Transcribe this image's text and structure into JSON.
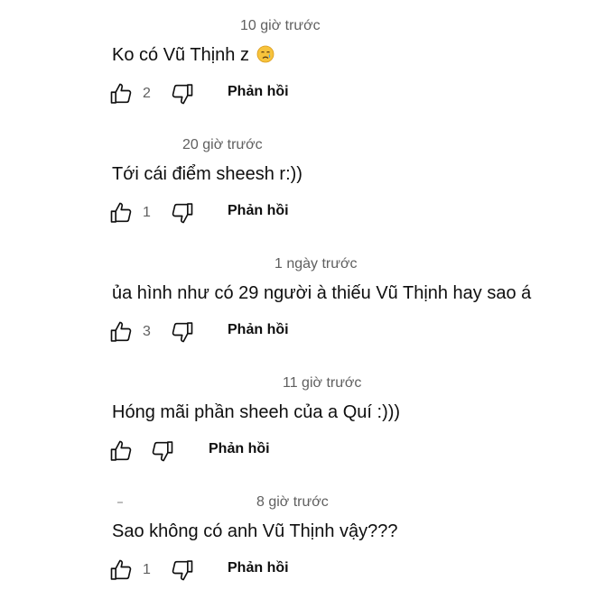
{
  "reply_label": "Phản hồi",
  "comments": [
    {
      "timestamp": "10 giờ trước",
      "text": "Ko có Vũ Thịnh z",
      "emoji": "crying-face-emoji",
      "likes": "2"
    },
    {
      "timestamp": "20 giờ trước",
      "text": "Tới cái điểm sheesh r:))",
      "likes": "1"
    },
    {
      "timestamp": "1 ngày trước",
      "text": "ủa hình như có 29 người à thiếu Vũ Thịnh hay sao á",
      "likes": "3"
    },
    {
      "timestamp": "11 giờ trước",
      "text": "Hóng mãi phần sheeh của a Quí :)))",
      "likes": ""
    },
    {
      "timestamp": "8 giờ trước",
      "text": "Sao không có anh Vũ Thịnh vậy???",
      "likes": "1"
    }
  ],
  "icons": {
    "like": "thumb-up-outline-icon",
    "dislike": "thumb-down-outline-icon"
  }
}
